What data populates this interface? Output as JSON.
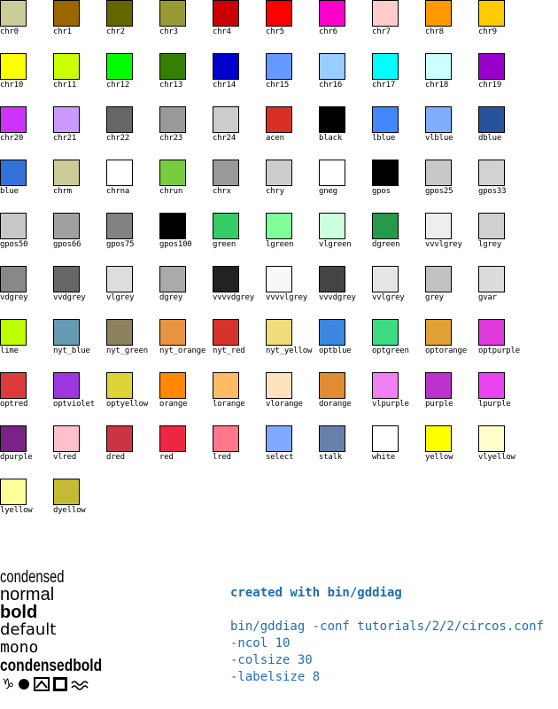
{
  "swatches": [
    {
      "name": "chr0",
      "color": "#cccc99"
    },
    {
      "name": "chr1",
      "color": "#996600"
    },
    {
      "name": "chr2",
      "color": "#666600"
    },
    {
      "name": "chr3",
      "color": "#999933"
    },
    {
      "name": "chr4",
      "color": "#cc0000"
    },
    {
      "name": "chr5",
      "color": "#ff0000"
    },
    {
      "name": "chr6",
      "color": "#ff00cc"
    },
    {
      "name": "chr7",
      "color": "#ffcccc"
    },
    {
      "name": "chr8",
      "color": "#ff9900"
    },
    {
      "name": "chr9",
      "color": "#ffcc00"
    },
    {
      "name": "chr10",
      "color": "#ffff00"
    },
    {
      "name": "chr11",
      "color": "#ccff00"
    },
    {
      "name": "chr12",
      "color": "#00ff00"
    },
    {
      "name": "chr13",
      "color": "#358000"
    },
    {
      "name": "chr14",
      "color": "#0000cc"
    },
    {
      "name": "chr15",
      "color": "#6699ff"
    },
    {
      "name": "chr16",
      "color": "#99ccff"
    },
    {
      "name": "chr17",
      "color": "#00ffff"
    },
    {
      "name": "chr18",
      "color": "#ccffff"
    },
    {
      "name": "chr19",
      "color": "#9900cc"
    },
    {
      "name": "chr20",
      "color": "#cc33ff"
    },
    {
      "name": "chr21",
      "color": "#cc99ff"
    },
    {
      "name": "chr22",
      "color": "#666666"
    },
    {
      "name": "chr23",
      "color": "#999999"
    },
    {
      "name": "chr24",
      "color": "#cccccc"
    },
    {
      "name": "acen",
      "color": "#d92f27"
    },
    {
      "name": "black",
      "color": "#000000"
    },
    {
      "name": "lblue",
      "color": "#4188ff"
    },
    {
      "name": "vlblue",
      "color": "#7fadff"
    },
    {
      "name": "dblue",
      "color": "#28529c"
    },
    {
      "name": "blue",
      "color": "#3373d9"
    },
    {
      "name": "chrm",
      "color": "#cccc99"
    },
    {
      "name": "chrna",
      "color": "#ffffff"
    },
    {
      "name": "chrun",
      "color": "#79cc3d"
    },
    {
      "name": "chrx",
      "color": "#999999"
    },
    {
      "name": "chry",
      "color": "#cccccc"
    },
    {
      "name": "gneg",
      "color": "#ffffff"
    },
    {
      "name": "gpos",
      "color": "#000000"
    },
    {
      "name": "gpos25",
      "color": "#c8c8c8"
    },
    {
      "name": "gpos33",
      "color": "#d2d2d2"
    },
    {
      "name": "gpos50",
      "color": "#c8c8c8"
    },
    {
      "name": "gpos66",
      "color": "#a0a0a0"
    },
    {
      "name": "gpos75",
      "color": "#828282"
    },
    {
      "name": "gpos100",
      "color": "#000000"
    },
    {
      "name": "green",
      "color": "#33cc66"
    },
    {
      "name": "lgreen",
      "color": "#80ff99"
    },
    {
      "name": "vlgreen",
      "color": "#ccffdd"
    },
    {
      "name": "dgreen",
      "color": "#26994d"
    },
    {
      "name": "vvvlgrey",
      "color": "#eeeeee"
    },
    {
      "name": "lgrey",
      "color": "#d0d0d0"
    },
    {
      "name": "vdgrey",
      "color": "#888888"
    },
    {
      "name": "vvdgrey",
      "color": "#666666"
    },
    {
      "name": "vlgrey",
      "color": "#dddddd"
    },
    {
      "name": "dgrey",
      "color": "#aaaaaa"
    },
    {
      "name": "vvvvdgrey",
      "color": "#222222"
    },
    {
      "name": "vvvvlgrey",
      "color": "#f8f8f8"
    },
    {
      "name": "vvvdgrey",
      "color": "#444444"
    },
    {
      "name": "vvlgrey",
      "color": "#e5e5e5"
    },
    {
      "name": "grey",
      "color": "#c2c2c2"
    },
    {
      "name": "gvar",
      "color": "#dcdcdc"
    },
    {
      "name": "lime",
      "color": "#bbff00"
    },
    {
      "name": "nyt_blue",
      "color": "#6699b3"
    },
    {
      "name": "nyt_green",
      "color": "#8c825e"
    },
    {
      "name": "nyt_orange",
      "color": "#e89440"
    },
    {
      "name": "nyt_red",
      "color": "#d9322b"
    },
    {
      "name": "nyt_yellow",
      "color": "#f0dc78"
    },
    {
      "name": "optblue",
      "color": "#3a86e0"
    },
    {
      "name": "optgreen",
      "color": "#3ddc84"
    },
    {
      "name": "optorange",
      "color": "#e0a235"
    },
    {
      "name": "optpurple",
      "color": "#de3adb"
    },
    {
      "name": "optred",
      "color": "#dd3b3b"
    },
    {
      "name": "optviolet",
      "color": "#9b36e0"
    },
    {
      "name": "optyellow",
      "color": "#dcd535"
    },
    {
      "name": "orange",
      "color": "#ff8800"
    },
    {
      "name": "lorange",
      "color": "#ffbb66"
    },
    {
      "name": "vlorange",
      "color": "#ffe3bf"
    },
    {
      "name": "dorange",
      "color": "#e08c33"
    },
    {
      "name": "vlpurple",
      "color": "#f280f2"
    },
    {
      "name": "purple",
      "color": "#bb33cc"
    },
    {
      "name": "lpurple",
      "color": "#ea44f2"
    },
    {
      "name": "dpurple",
      "color": "#7a2285"
    },
    {
      "name": "vlred",
      "color": "#ffbfcc"
    },
    {
      "name": "dred",
      "color": "#cc3344"
    },
    {
      "name": "red",
      "color": "#ee2644"
    },
    {
      "name": "lred",
      "color": "#ff7788"
    },
    {
      "name": "select",
      "color": "#80aaff"
    },
    {
      "name": "stalk",
      "color": "#6680aa"
    },
    {
      "name": "white",
      "color": "#ffffff"
    },
    {
      "name": "yellow",
      "color": "#ffff00"
    },
    {
      "name": "vlyellow",
      "color": "#ffffcc"
    },
    {
      "name": "lyellow",
      "color": "#ffff99"
    },
    {
      "name": "dyellow",
      "color": "#c4bb33"
    }
  ],
  "font_samples": {
    "condensed": "condensed",
    "normal": "normal",
    "bold": "bold",
    "default": "default",
    "mono": "mono",
    "condensedbold": "condensedbold"
  },
  "symbols": {
    "capricorn": "♑",
    "items": [
      "capricorn-glyph",
      "filled-circle",
      "mountain-box",
      "open-square",
      "wave-lines"
    ]
  },
  "note": {
    "title": "created with bin/gddiag",
    "command_lines": [
      "bin/gddiag -conf tutorials/2/2/circos.conf",
      "           -ncol 10",
      "           -colsize 30",
      "           -labelsize 8"
    ],
    "text_color": "#1f6fb2"
  }
}
